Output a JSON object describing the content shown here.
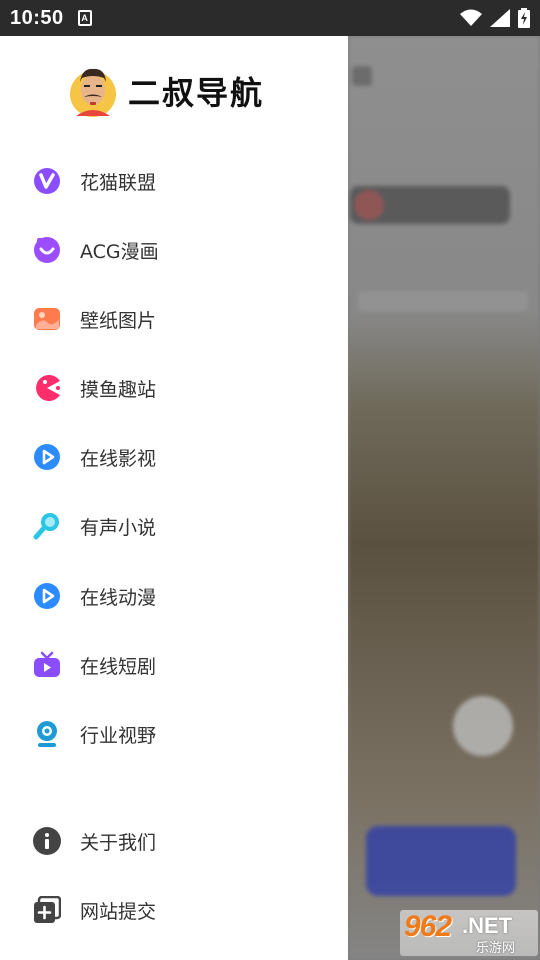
{
  "status_bar": {
    "time": "10:50",
    "notification_glyph": "A",
    "icons": [
      "wifi-icon",
      "signal-icon",
      "battery-charging-icon"
    ]
  },
  "drawer": {
    "brand_title": "二叔导航",
    "avatar_icon": "mustache-man-avatar",
    "items": [
      {
        "label": "花猫联盟",
        "icon": "purple-v-icon",
        "color": "#8a4dff"
      },
      {
        "label": "ACG漫画",
        "icon": "purple-smile-bubble-icon",
        "color": "#9b4dff"
      },
      {
        "label": "壁纸图片",
        "icon": "orange-landscape-icon",
        "color": "#ff7a4d"
      },
      {
        "label": "摸鱼趣站",
        "icon": "pink-pacman-icon",
        "color": "#ff2d6b"
      },
      {
        "label": "在线影视",
        "icon": "blue-play-icon",
        "color": "#2c8bff"
      },
      {
        "label": "有声小说",
        "icon": "cyan-search-icon",
        "color": "#2bc6e6"
      },
      {
        "label": "在线动漫",
        "icon": "blue-play-icon",
        "color": "#2c8bff"
      },
      {
        "label": "在线短剧",
        "icon": "purple-tv-icon",
        "color": "#8a4dff"
      },
      {
        "label": "行业视野",
        "icon": "blue-webcam-icon",
        "color": "#1e9bd7"
      }
    ],
    "bottom_items": [
      {
        "label": "关于我们",
        "icon": "info-circle-icon",
        "color": "#444444"
      },
      {
        "label": "网站提交",
        "icon": "add-square-icon",
        "color": "#444444"
      }
    ]
  },
  "watermark": {
    "number": "962",
    "suffix": ".NET",
    "site": "乐游网"
  }
}
